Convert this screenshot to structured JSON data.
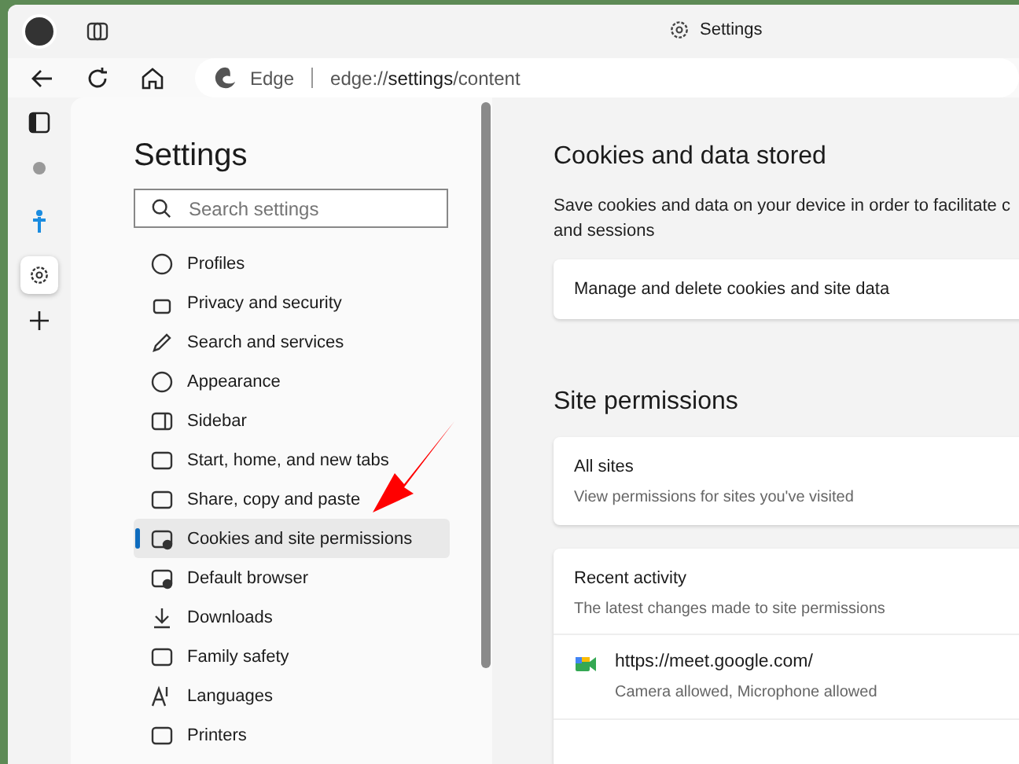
{
  "window": {
    "title": "Settings"
  },
  "toolbar": {
    "address_label": "Edge",
    "url_prefix": "edge://",
    "url_host": "settings",
    "url_path": "/content"
  },
  "vertical_tabs": [
    {
      "kind": "favicon",
      "selected": false
    },
    {
      "kind": "figure",
      "selected": false
    },
    {
      "kind": "gear",
      "selected": true
    }
  ],
  "nav": {
    "title": "Settings",
    "search": {
      "placeholder": "Search settings"
    },
    "items": [
      {
        "label": "Profiles",
        "selected": false
      },
      {
        "label": "Privacy and security",
        "selected": false
      },
      {
        "label": "Search and services",
        "selected": false
      },
      {
        "label": "Appearance",
        "selected": false
      },
      {
        "label": "Sidebar",
        "selected": false
      },
      {
        "label": "Start, home, and new tabs",
        "selected": false
      },
      {
        "label": "Share, copy and paste",
        "selected": false
      },
      {
        "label": "Cookies and site permissions",
        "selected": true
      },
      {
        "label": "Default browser",
        "selected": false
      },
      {
        "label": "Downloads",
        "selected": false
      },
      {
        "label": "Family safety",
        "selected": false
      },
      {
        "label": "Languages",
        "selected": false
      },
      {
        "label": "Printers",
        "selected": false
      }
    ]
  },
  "cookies": {
    "title": "Cookies and data stored",
    "description_lines": [
      "Save cookies and data on your device in order to facilitate c",
      "and sessions"
    ],
    "link_card": "Manage and delete cookies and site data"
  },
  "permissions": {
    "title": "Site permissions",
    "all_sites": {
      "title": "All sites",
      "subtitle": "View permissions for sites you've visited"
    },
    "recent": {
      "title": "Recent activity",
      "subtitle": "The latest changes made to site permissions",
      "rows": [
        {
          "url": "https://meet.google.com/",
          "detail": "Camera allowed, Microphone allowed"
        }
      ]
    }
  }
}
